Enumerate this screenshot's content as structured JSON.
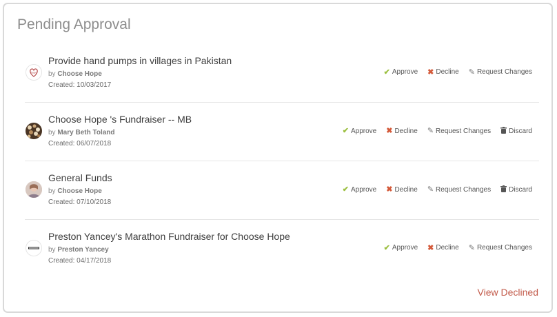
{
  "panel": {
    "title": "Pending Approval",
    "view_declined_label": "View Declined"
  },
  "labels": {
    "by": "by",
    "created_prefix": "Created:",
    "approve": "Approve",
    "decline": "Decline",
    "request_changes": "Request Changes",
    "discard": "Discard"
  },
  "items": [
    {
      "title": "Provide hand pumps in villages in Pakistan",
      "author": "Choose Hope",
      "created": "10/03/2017",
      "avatar": "heart-logo"
    },
    {
      "title": "Choose Hope 's Fundraiser -- MB",
      "author": "Mary Beth Toland",
      "created": "06/07/2018",
      "avatar": "pebbles-photo"
    },
    {
      "title": "General Funds",
      "author": "Choose Hope",
      "created": "07/10/2018",
      "avatar": "person-photo"
    },
    {
      "title": "Preston Yancey's Marathon Fundraiser for Choose Hope",
      "author": "Preston Yancey",
      "created": "04/17/2018",
      "avatar": "choose-hope-logo"
    }
  ],
  "colors": {
    "approve": "#9bbf3f",
    "decline": "#d45a3a",
    "link": "#c25a4a"
  }
}
